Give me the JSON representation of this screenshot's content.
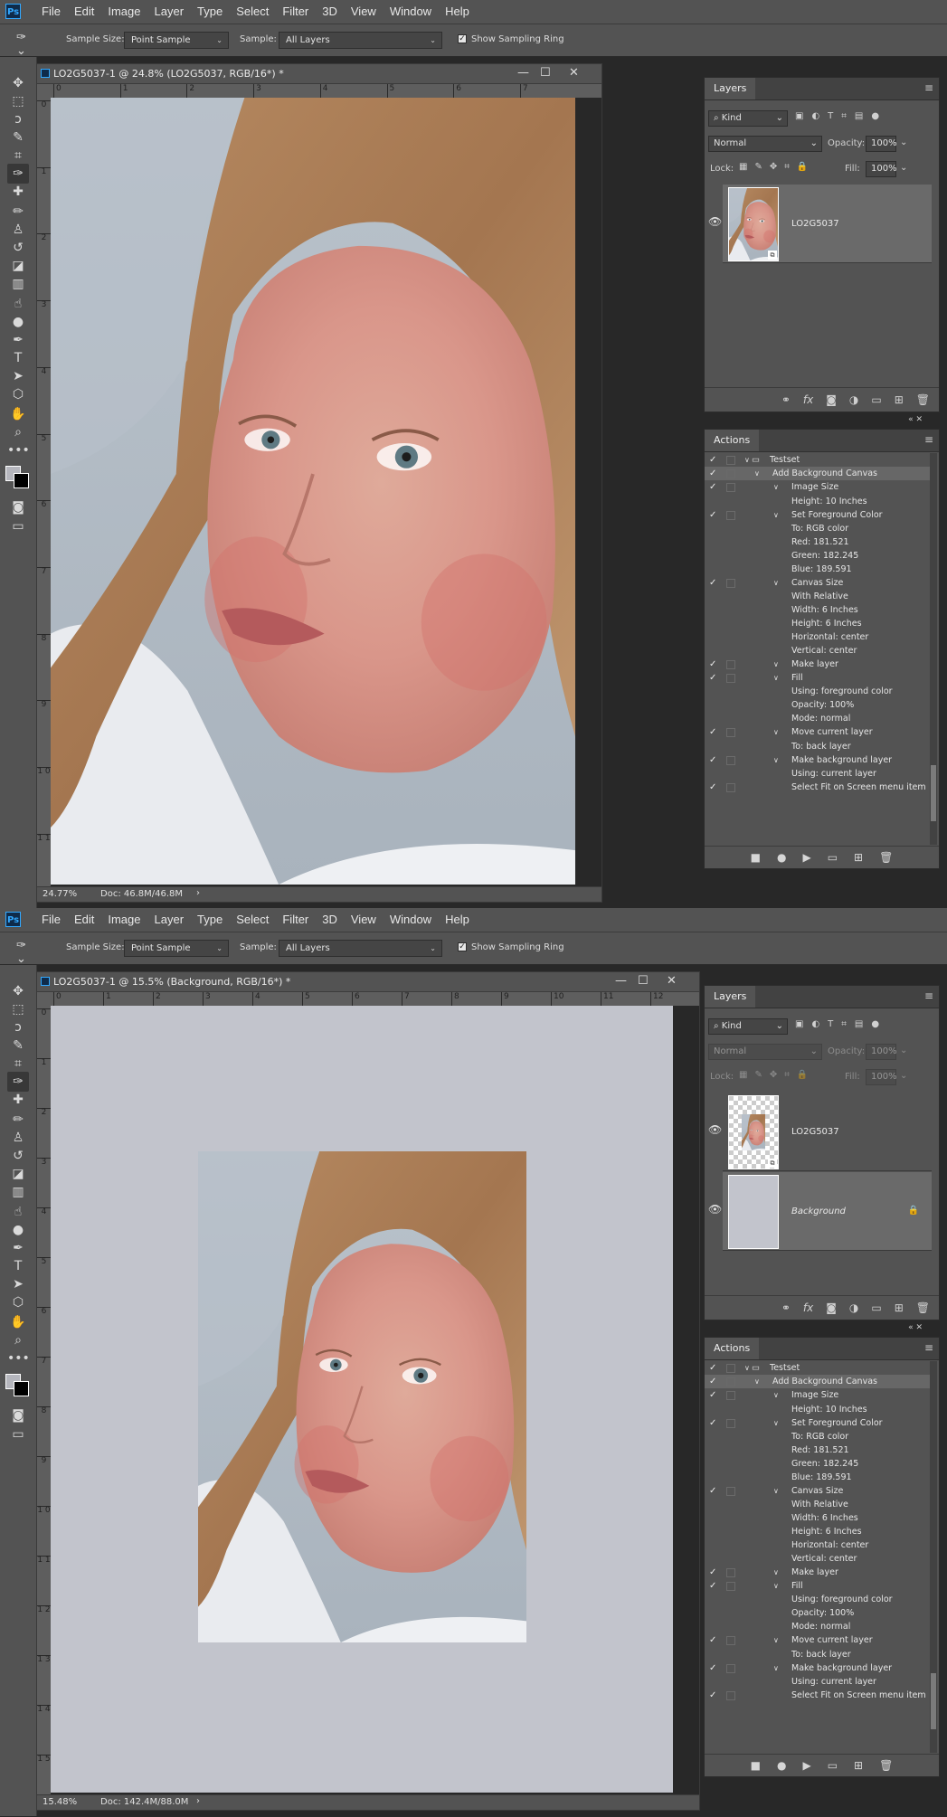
{
  "menu": [
    "File",
    "Edit",
    "Image",
    "Layer",
    "Type",
    "Select",
    "Filter",
    "3D",
    "View",
    "Window",
    "Help"
  ],
  "app_logo": "Ps",
  "options": {
    "sample_size_label": "Sample Size:",
    "sample_size_value": "Point Sample",
    "sample_label": "Sample:",
    "sample_value": "All Layers",
    "show_ring_label": "Show Sampling Ring",
    "show_ring_checked": true
  },
  "tools": [
    "move-icon",
    "marquee-icon",
    "lasso-icon",
    "quick-select-icon",
    "crop-icon",
    "eyedropper-icon",
    "healing-brush-icon",
    "brush-icon",
    "clone-stamp-icon",
    "history-brush-icon",
    "eraser-icon",
    "gradient-icon",
    "smudge-icon",
    "dodge-icon",
    "pen-icon",
    "type-icon",
    "path-select-icon",
    "shape-icon",
    "hand-icon",
    "zoom-icon",
    "more-tools-icon"
  ],
  "tool_glyphs": [
    "✥",
    "⬚",
    "ↄ",
    "✎",
    "⌗",
    "✑",
    "✚",
    "✏",
    "♙",
    "↺",
    "◪",
    "▥",
    "☝",
    "●",
    "✒",
    "T",
    "➤",
    "⬡",
    "✋",
    "⌕",
    "•••"
  ],
  "colors": {
    "foreground": "#b5b6bd",
    "background": "#000000",
    "canvas_bg": "#c2c4cc"
  },
  "screens": [
    {
      "doc_title": "LO2G5037-1 @ 24.8% (LO2G5037, RGB/16*) *",
      "ruler_h": [
        "0",
        "1",
        "2",
        "3",
        "4",
        "5",
        "6",
        "7"
      ],
      "ruler_v": [
        "0",
        "1",
        "2",
        "3",
        "4",
        "5",
        "6",
        "7",
        "8",
        "9",
        "1 0",
        "1 1"
      ],
      "zoom": "24.77%",
      "doc_size": "Doc: 46.8M/46.8M",
      "layers_tab": "Layers",
      "filter_kind": "Kind",
      "blend_mode": "Normal",
      "opacity_label": "Opacity:",
      "opacity": "100%",
      "lock_label": "Lock:",
      "fill_label": "Fill:",
      "fill": "100%",
      "layers": [
        {
          "name": "LO2G5037"
        }
      ],
      "actions_tab": "Actions"
    },
    {
      "doc_title": "LO2G5037-1 @ 15.5% (Background, RGB/16*) *",
      "ruler_h": [
        "0",
        "1",
        "2",
        "3",
        "4",
        "5",
        "6",
        "7",
        "8",
        "9",
        "10",
        "11",
        "12"
      ],
      "ruler_v": [
        "0",
        "1",
        "2",
        "3",
        "4",
        "5",
        "6",
        "7",
        "8",
        "9",
        "1 0",
        "1 1",
        "1 2",
        "1 3",
        "1 4",
        "1 5"
      ],
      "zoom": "15.48%",
      "doc_size": "Doc: 142.4M/88.0M",
      "layers_tab": "Layers",
      "filter_kind": "Kind",
      "blend_mode": "Normal",
      "opacity_label": "Opacity:",
      "opacity": "100%",
      "lock_label": "Lock:",
      "fill_label": "Fill:",
      "fill": "100%",
      "layers": [
        {
          "name": "LO2G5037"
        },
        {
          "name": "Background"
        }
      ],
      "actions_tab": "Actions"
    }
  ],
  "actions": [
    {
      "check": true,
      "box": false,
      "twirl": "⌄",
      "folder": true,
      "text": "Testset",
      "level": 0
    },
    {
      "check": true,
      "box": false,
      "twirl": "⌄",
      "text": "Add Background Canvas",
      "level": 1,
      "selected": true
    },
    {
      "check": true,
      "box": false,
      "twirl": "⌄",
      "text": "Image Size",
      "level": 2
    },
    {
      "check": false,
      "text": "Height: 10 Inches",
      "level": 3
    },
    {
      "check": true,
      "box": false,
      "twirl": "⌄",
      "text": "Set Foreground Color",
      "level": 2
    },
    {
      "check": false,
      "text": "To: RGB color",
      "level": 3
    },
    {
      "check": false,
      "text": "Red: 181.521",
      "level": 3
    },
    {
      "check": false,
      "text": "Green: 182.245",
      "level": 3
    },
    {
      "check": false,
      "text": "Blue: 189.591",
      "level": 3
    },
    {
      "check": true,
      "box": false,
      "twirl": "⌄",
      "text": "Canvas Size",
      "level": 2
    },
    {
      "check": false,
      "text": "With Relative",
      "level": 3
    },
    {
      "check": false,
      "text": "Width: 6 Inches",
      "level": 3
    },
    {
      "check": false,
      "text": "Height: 6 Inches",
      "level": 3
    },
    {
      "check": false,
      "text": "Horizontal: center",
      "level": 3
    },
    {
      "check": false,
      "text": "Vertical: center",
      "level": 3
    },
    {
      "check": true,
      "box": false,
      "twirl": "⌄",
      "text": "Make layer",
      "level": 2
    },
    {
      "check": true,
      "box": false,
      "twirl": "⌄",
      "text": "Fill",
      "level": 2
    },
    {
      "check": false,
      "text": "Using: foreground color",
      "level": 3
    },
    {
      "check": false,
      "text": "Opacity: 100%",
      "level": 3
    },
    {
      "check": false,
      "text": "Mode: normal",
      "level": 3
    },
    {
      "check": true,
      "box": false,
      "twirl": "⌄",
      "text": "Move current layer",
      "level": 2
    },
    {
      "check": false,
      "text": "To: back layer",
      "level": 3
    },
    {
      "check": true,
      "box": false,
      "twirl": "⌄",
      "text": "Make background layer",
      "level": 2
    },
    {
      "check": false,
      "text": "Using: current layer",
      "level": 3
    },
    {
      "check": true,
      "box": false,
      "text": "Select Fit on Screen menu item",
      "level": 2
    }
  ]
}
